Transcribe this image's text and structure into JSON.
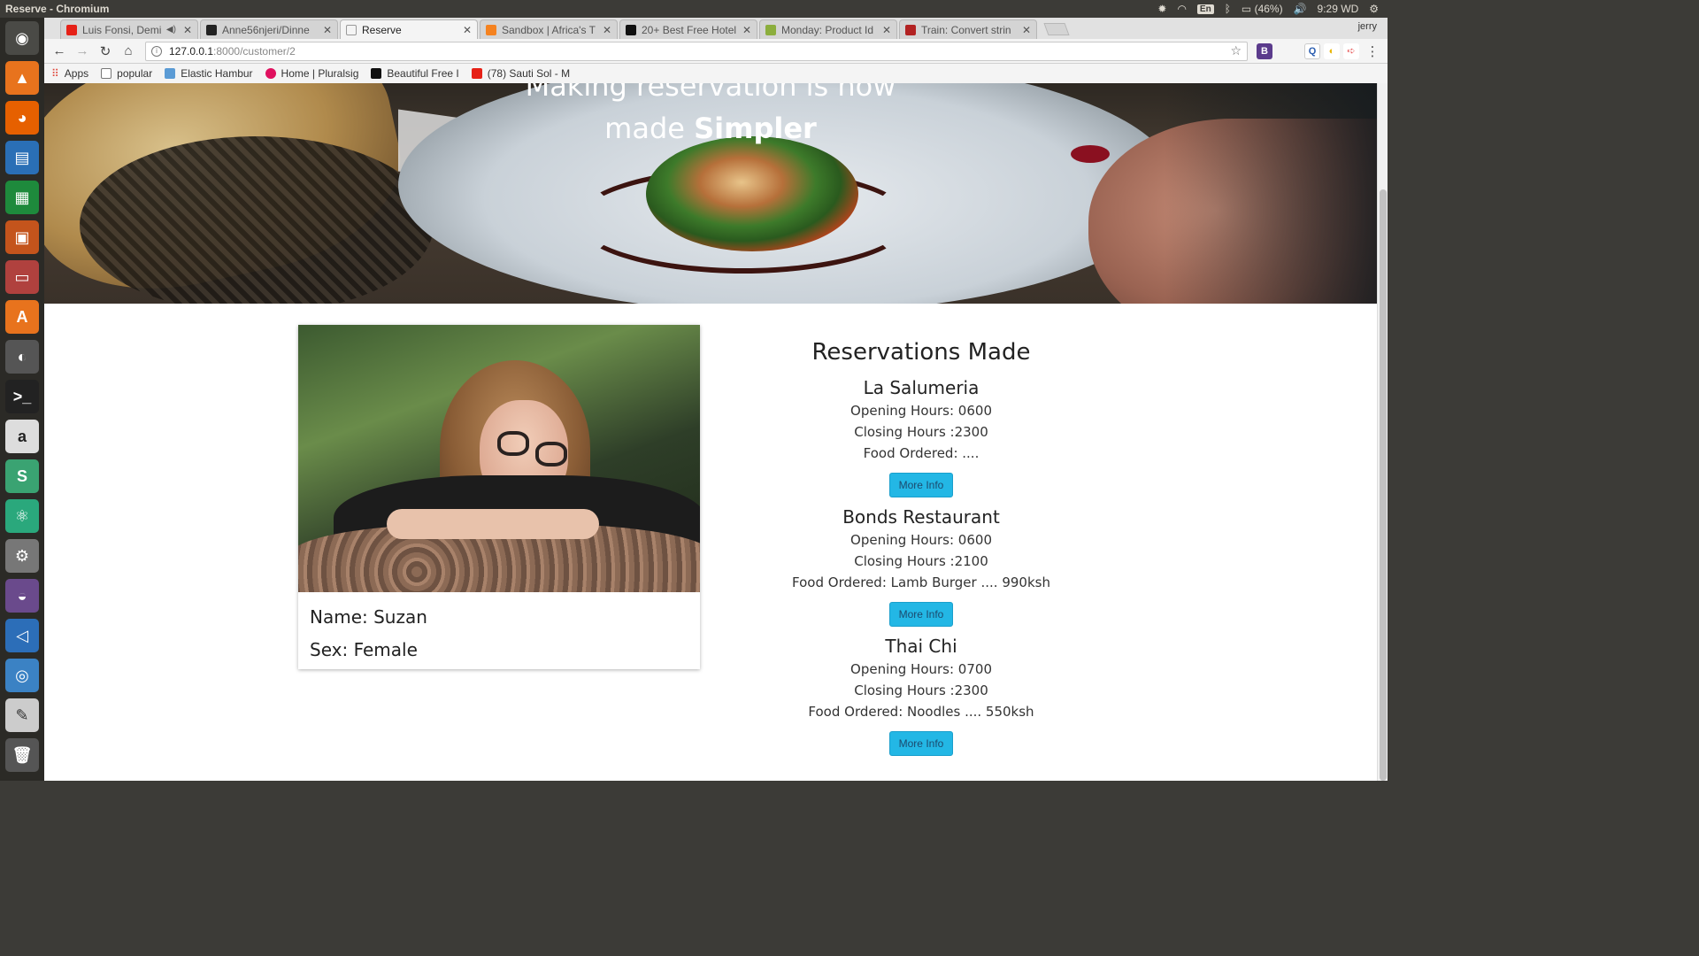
{
  "window": {
    "title": "Reserve - Chromium"
  },
  "top_panel": {
    "battery": "(46%)",
    "time": "9:29 WD",
    "lang": "En"
  },
  "tabs": [
    {
      "label": "Luis Fonsi, Demi",
      "color": "#e62117",
      "active": false
    },
    {
      "label": "Anne56njeri/Dinne",
      "color": "#222222",
      "active": false
    },
    {
      "label": "Reserve",
      "color": "#ffffff",
      "active": true
    },
    {
      "label": "Sandbox | Africa's T",
      "color": "#f5821f",
      "active": false
    },
    {
      "label": "20+ Best Free Hotel",
      "color": "#111111",
      "active": false
    },
    {
      "label": "Monday: Product Id",
      "color": "#8cae3d",
      "active": false
    },
    {
      "label": "Train: Convert strin",
      "color": "#b22222",
      "active": false
    }
  ],
  "user_name": "jerry",
  "address": {
    "host": "127.0.0.1",
    "path": ":8000/customer/2"
  },
  "bookmarks": [
    {
      "label": "Apps",
      "color": "#e04a3f"
    },
    {
      "label": "popular",
      "color": "#ffffff"
    },
    {
      "label": "Elastic Hambur",
      "color": "#5b9bd5"
    },
    {
      "label": "Home | Pluralsig",
      "color": "#e0115f"
    },
    {
      "label": "Beautiful Free I",
      "color": "#111111"
    },
    {
      "label": "(78) Sauti Sol - M",
      "color": "#e62117"
    }
  ],
  "hero": {
    "line1": "Making reservation is now",
    "line2_prefix": "made",
    "line2_bold": "Simpler"
  },
  "profile": {
    "name": "Name: Suzan",
    "sex": "Sex: Female"
  },
  "reservations": {
    "heading": "Reservations Made",
    "items": [
      {
        "name": "La Salumeria",
        "opening": "Opening Hours: 0600",
        "closing": "Closing Hours :2300",
        "food": "Food Ordered: ....",
        "button": "More Info"
      },
      {
        "name": "Bonds Restaurant",
        "opening": "Opening Hours: 0600",
        "closing": "Closing Hours :2100",
        "food": "Food Ordered: Lamb Burger .... 990ksh",
        "button": "More Info"
      },
      {
        "name": "Thai Chi",
        "opening": "Opening Hours: 0700",
        "closing": "Closing Hours :2300",
        "food": "Food Ordered: Noodles .... 550ksh",
        "button": "More Info"
      }
    ]
  },
  "colors": {
    "button": "#23b7e5",
    "panel": "#3c3b37"
  }
}
